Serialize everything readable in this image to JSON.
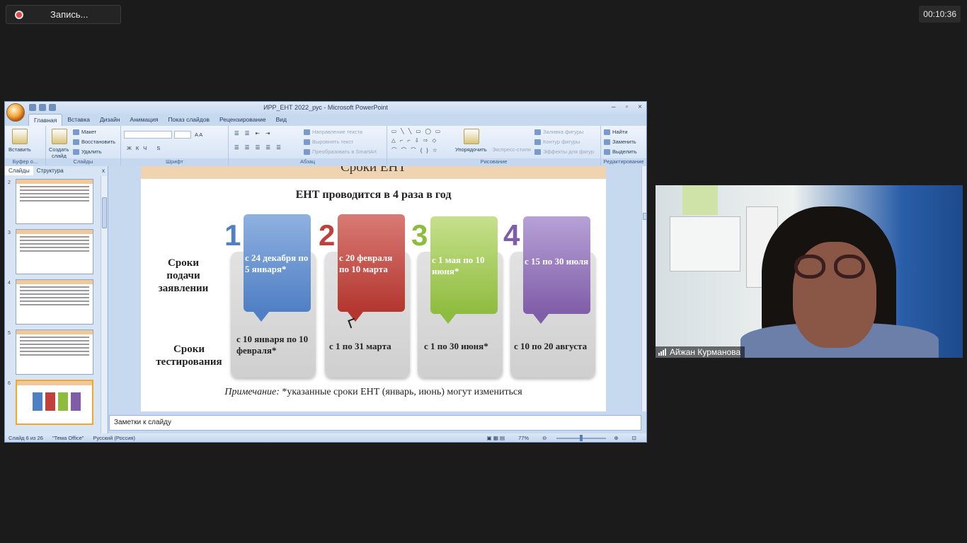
{
  "meeting": {
    "recording_label": "Запись...",
    "timer": "00:10:36",
    "participant_name": "Айжан Курманова"
  },
  "ppt": {
    "window_title": "ИРР_ЕНТ 2022_рус - Microsoft PowerPoint",
    "tabs": [
      "Главная",
      "Вставка",
      "Дизайн",
      "Анимация",
      "Показ слайдов",
      "Рецензирование",
      "Вид"
    ],
    "ribbon": {
      "clipboard": {
        "paste": "Вставить",
        "group": "Буфер о..."
      },
      "slides": {
        "new_slide_1": "Создать",
        "new_slide_2": "слайд",
        "layout": "Макет",
        "reset": "Восстановить",
        "delete": "Удалить",
        "group": "Слайды"
      },
      "font": {
        "group": "Шрифт"
      },
      "paragraph": {
        "text_direction": "Направление текста",
        "align_text": "Выровнять текст",
        "smartart": "Преобразовать в SmartArt",
        "group": "Абзац"
      },
      "drawing": {
        "arrange": "Упорядочить",
        "quick_styles": "Экспресс-стили",
        "fill": "Заливка фигуры",
        "outline": "Контур фигуры",
        "effects": "Эффекты для фигур",
        "group": "Рисование"
      },
      "editing": {
        "find": "Найти",
        "replace": "Заменить",
        "select": "Выделить",
        "group": "Редактирование"
      }
    },
    "side_panel": {
      "tab_slides": "Слайды",
      "tab_outline": "Структура",
      "close": "x"
    },
    "thumbnails": [
      {
        "num": "2"
      },
      {
        "num": "3"
      },
      {
        "num": "4"
      },
      {
        "num": "5"
      },
      {
        "num": "6"
      }
    ],
    "slide": {
      "title_cut": "Сроки ЕНТ",
      "heading": "ЕНТ проводится в 4 раза в год",
      "row1_label_l1": "Сроки",
      "row1_label_l2": "подачи",
      "row1_label_l3": "заявлении",
      "row2_label_l1": "Сроки",
      "row2_label_l2": "тестирования",
      "columns": [
        {
          "num": "1",
          "apply": "с 24 декабря по 5 января*",
          "test": "с 10 января  по 10 февраля*",
          "color": "#4f7fc4"
        },
        {
          "num": "2",
          "apply": "с 20 февраля по 10 марта",
          "test": "с 1 по 31 марта",
          "color": "#c0403c"
        },
        {
          "num": "3",
          "apply": "с 1 мая по 10 июня*",
          "test": "с 1 по 30 июня*",
          "color": "#8ebc3e"
        },
        {
          "num": "4",
          "apply": "с 15 по 30 июля",
          "test": "с 10 по 20 августа",
          "color": "#7f5da8"
        }
      ],
      "note_label": "Примечание:",
      "note_text": " *указанные сроки ЕНТ (январь, июнь) могут измениться"
    },
    "notes_placeholder": "Заметки к слайду",
    "status": {
      "slide_counter": "Слайд 6 из 26",
      "theme": "\"Тема Office\"",
      "language": "Русский (Россия)",
      "zoom": "77%"
    }
  }
}
